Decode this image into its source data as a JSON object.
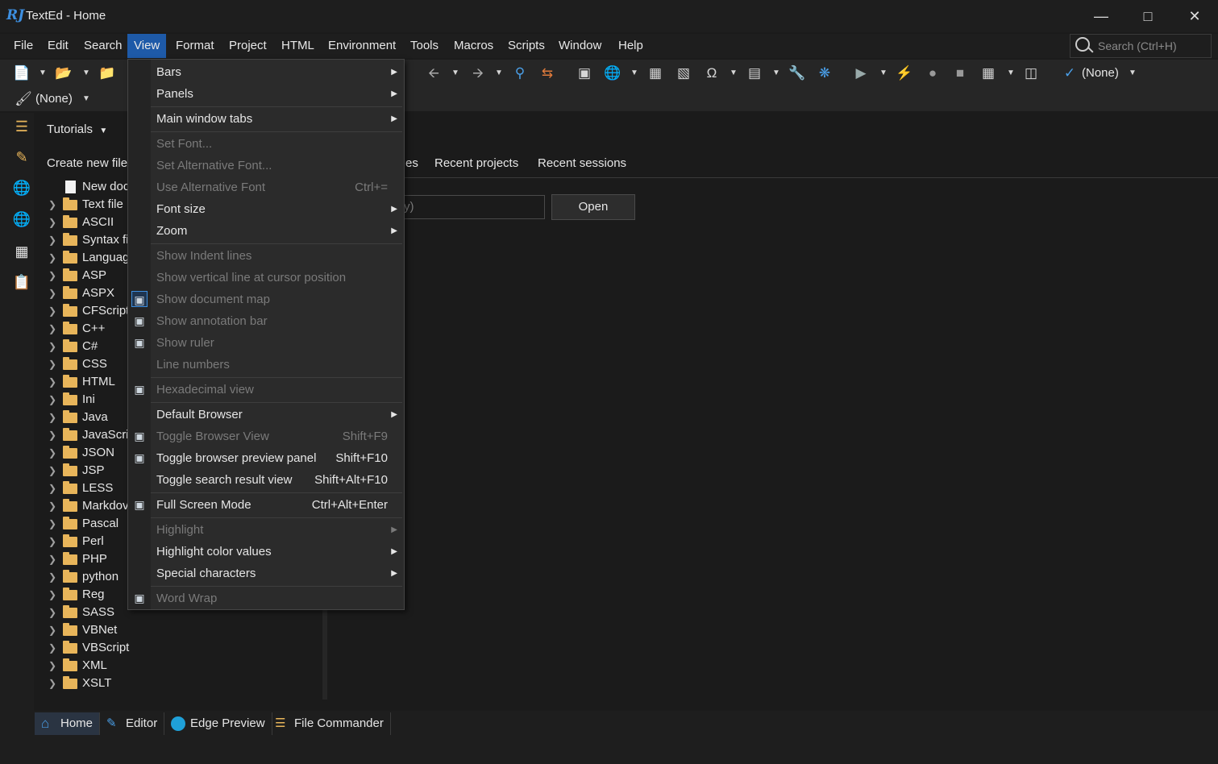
{
  "window": {
    "logo": "RJ",
    "title": "TextEd - Home",
    "minimize_icon": "minimize-icon",
    "maximize_icon": "maximize-icon",
    "close_icon": "close-icon"
  },
  "menubar": {
    "items": [
      {
        "label": "File"
      },
      {
        "label": "Edit"
      },
      {
        "label": "Search"
      },
      {
        "label": "View",
        "active": true
      },
      {
        "label": "Format"
      },
      {
        "label": "Project"
      },
      {
        "label": "HTML"
      },
      {
        "label": "Environment"
      },
      {
        "label": "Tools"
      },
      {
        "label": "Macros"
      },
      {
        "label": "Scripts"
      },
      {
        "label": "Window"
      },
      {
        "label": "Help"
      }
    ],
    "search_placeholder": "Search (Ctrl+H)"
  },
  "toolbar": {
    "spell_lang": "(None)",
    "brush_value": "(None)"
  },
  "sidebar": {
    "icons": [
      "tree-icon",
      "paint-icon",
      "globe-icon",
      "globe-check-icon",
      "layout-icon",
      "clipboard-icon"
    ]
  },
  "tree": {
    "header": "Tutorials",
    "create_new": "Create new file",
    "new_doc": "New doc",
    "folders": [
      "Text file",
      "ASCII",
      "Syntax fi",
      "Languag",
      "ASP",
      "ASPX",
      "CFScript",
      "C++",
      "C#",
      "CSS",
      "HTML",
      "Ini",
      "Java",
      "JavaScrip",
      "JSON",
      "JSP",
      "LESS",
      "Markdov",
      "Pascal",
      "Perl",
      "PHP",
      "python",
      "Reg",
      "SASS",
      "VBNet",
      "VBScript",
      "XML",
      "XSLT"
    ]
  },
  "main": {
    "tabs": [
      "es",
      "Recent projects",
      "Recent sessions"
    ],
    "path_placeholder": "y)",
    "open_label": "Open"
  },
  "view_menu": {
    "items": [
      {
        "label": "Bars",
        "arrow": true
      },
      {
        "label": "Panels",
        "arrow": true
      },
      {
        "sep": true
      },
      {
        "label": "Main window tabs",
        "arrow": true
      },
      {
        "sep": true
      },
      {
        "label": "Set Font...",
        "disabled": true
      },
      {
        "label": "Set Alternative Font...",
        "disabled": true
      },
      {
        "label": "Use Alternative Font",
        "disabled": true,
        "shortcut": "Ctrl+="
      },
      {
        "label": "Font size",
        "arrow": true
      },
      {
        "label": "Zoom",
        "arrow": true
      },
      {
        "sep": true
      },
      {
        "label": "Show Indent lines",
        "disabled": true
      },
      {
        "label": "Show vertical line at cursor position",
        "disabled": true
      },
      {
        "label": "Show document map",
        "disabled": true,
        "icon": "document-map-icon",
        "checked": true
      },
      {
        "label": "Show annotation bar",
        "disabled": true,
        "icon": "annotation-icon"
      },
      {
        "label": "Show ruler",
        "disabled": true,
        "icon": "ruler-icon"
      },
      {
        "label": "Line numbers",
        "disabled": true
      },
      {
        "sep": true
      },
      {
        "label": "Hexadecimal view",
        "disabled": true,
        "icon": "hex-icon"
      },
      {
        "sep": true
      },
      {
        "label": "Default Browser",
        "arrow": true
      },
      {
        "label": "Toggle Browser View",
        "disabled": true,
        "shortcut": "Shift+F9",
        "icon": "browser-view-icon"
      },
      {
        "label": "Toggle browser preview panel",
        "shortcut": "Shift+F10",
        "icon": "browser-preview-icon"
      },
      {
        "label": "Toggle search result view",
        "shortcut": "Shift+Alt+F10"
      },
      {
        "sep": true
      },
      {
        "label": "Full Screen Mode",
        "shortcut": "Ctrl+Alt+Enter",
        "icon": "fullscreen-icon"
      },
      {
        "sep": true
      },
      {
        "label": "Highlight",
        "disabled": true,
        "arrow": true
      },
      {
        "label": "Highlight color values",
        "arrow": true
      },
      {
        "label": "Special characters",
        "arrow": true
      },
      {
        "sep": true
      },
      {
        "label": "Word Wrap",
        "disabled": true,
        "icon": "word-wrap-icon"
      }
    ]
  },
  "bottom_tabs": [
    {
      "label": "Home",
      "icon": "home-icon",
      "active": true
    },
    {
      "label": "Editor",
      "icon": "pencil-icon"
    },
    {
      "label": "Edge Preview",
      "icon": "edge-icon"
    },
    {
      "label": "File Commander",
      "icon": "file-commander-icon"
    }
  ]
}
